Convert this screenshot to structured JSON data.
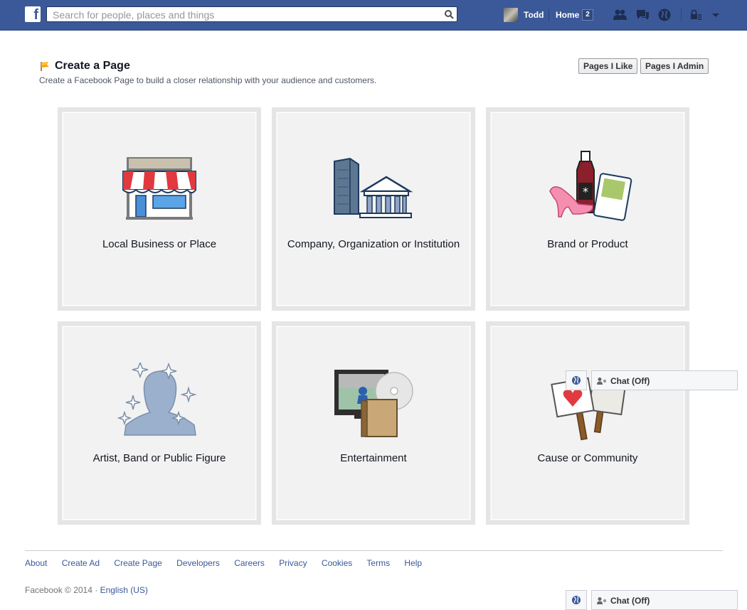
{
  "topbar": {
    "search_placeholder": "Search for people, places and things",
    "user_name": "Todd",
    "home_label": "Home",
    "home_count": "2"
  },
  "header": {
    "title": "Create a Page",
    "subtitle": "Create a Facebook Page to build a closer relationship with your audience and customers.",
    "pages_like_label": "Pages I Like",
    "pages_admin_label": "Pages I Admin"
  },
  "tiles": [
    {
      "label": "Local Business or Place",
      "icon": "storefront-icon"
    },
    {
      "label": "Company, Organization or Institution",
      "icon": "company-building-icon"
    },
    {
      "label": "Brand or Product",
      "icon": "brand-product-icon"
    },
    {
      "label": "Artist, Band or Public Figure",
      "icon": "artist-silhouette-icon"
    },
    {
      "label": "Entertainment",
      "icon": "entertainment-icon"
    },
    {
      "label": "Cause or Community",
      "icon": "cause-signs-icon"
    }
  ],
  "footer": {
    "links": [
      "About",
      "Create Ad",
      "Create Page",
      "Developers",
      "Careers",
      "Privacy",
      "Cookies",
      "Terms",
      "Help"
    ],
    "copyright": "Facebook © 2014 · ",
    "language": "English (US)"
  },
  "chat": {
    "label": "Chat (Off)"
  },
  "colors": {
    "brand_blue": "#3b5998",
    "tile_border": "#e5e5e5",
    "tile_bg": "#f2f2f2"
  }
}
